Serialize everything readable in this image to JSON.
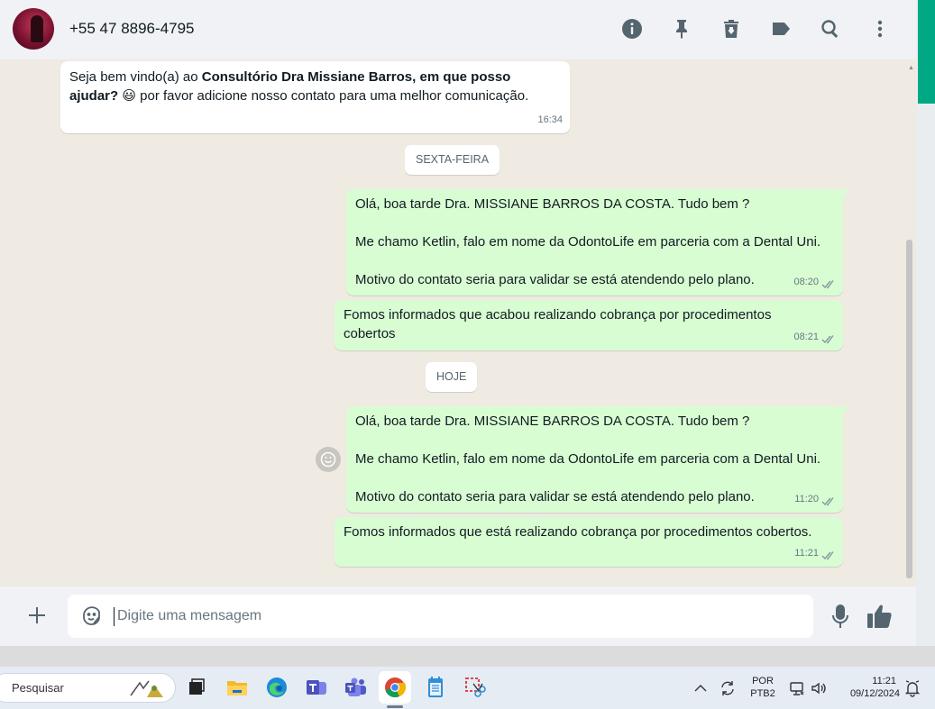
{
  "header": {
    "contact_name": "+55 47 8896-4795",
    "icons": [
      "info-icon",
      "pin-icon",
      "delete-icon",
      "label-icon",
      "search-icon",
      "more-options-icon"
    ]
  },
  "messages": [
    {
      "direction": "in",
      "parts": [
        {
          "text": "Seja bem vindo(a) ao ",
          "bold": false
        },
        {
          "text": "Consultório Dra Missiane Barros, em que posso ajudar?",
          "bold": true
        },
        {
          "text": " 😃 por favor adicione nosso contato para uma melhor comunicação.",
          "bold": false
        }
      ],
      "time": "16:34"
    },
    {
      "type": "date",
      "label": "SEXTA-FEIRA"
    },
    {
      "direction": "out",
      "lines": [
        "Olá, boa tarde Dra. MISSIANE BARROS DA COSTA. Tudo bem ?",
        "",
        "Me chamo Ketlin, falo em nome da OdontoLife em parceria com a Dental Uni.",
        "",
        "Motivo do contato seria para validar se está atendendo pelo plano."
      ],
      "time": "08:20"
    },
    {
      "direction": "out",
      "lines": [
        "Fomos informados que acabou realizando cobrança por procedimentos",
        "cobertos"
      ],
      "time": "08:21"
    },
    {
      "type": "date",
      "label": "HOJE"
    },
    {
      "direction": "out",
      "lines": [
        "Olá, boa tarde Dra. MISSIANE BARROS DA COSTA. Tudo bem ?",
        "",
        "Me chamo Ketlin, falo em nome da OdontoLife em parceria com a Dental Uni.",
        "",
        "Motivo do contato seria para validar se está atendendo pelo plano."
      ],
      "time": "11:20"
    },
    {
      "direction": "out",
      "lines": [
        "Fomos informados que está realizando cobrança por procedimentos cobertos."
      ],
      "time": "11:21"
    }
  ],
  "compose": {
    "placeholder": "Digite uma mensagem",
    "value": ""
  },
  "taskbar": {
    "search_placeholder": "Pesquisar",
    "language_line1": "POR",
    "language_line2": "PTB2",
    "time": "11:21",
    "date": "09/12/2024"
  },
  "colors": {
    "outgoing_bubble": "#d9fdd3",
    "incoming_bubble": "#ffffff",
    "chat_background": "#efeae2",
    "accent": "#00a884"
  }
}
